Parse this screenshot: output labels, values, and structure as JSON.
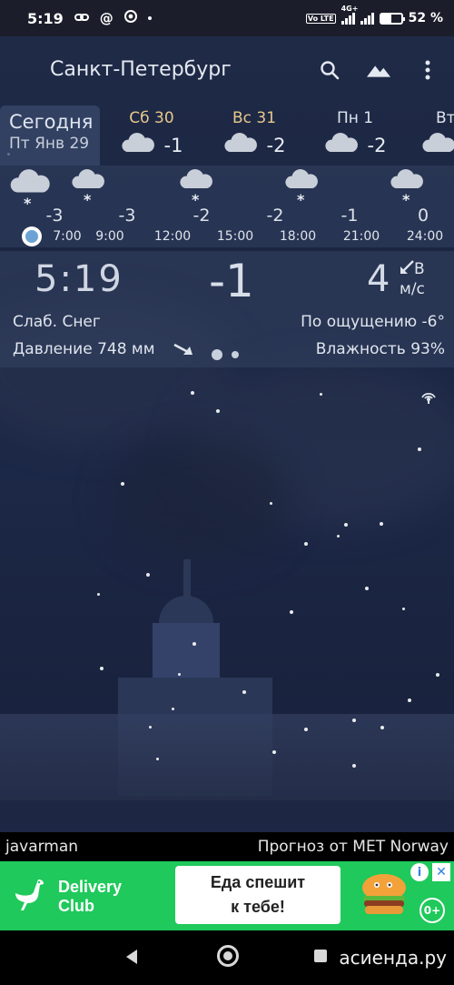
{
  "status_bar": {
    "time": "5:19",
    "icons": [
      "link-icon",
      "at-icon",
      "chrome-icon"
    ],
    "net_volte": "Vo LTE",
    "net_type": "4G+",
    "battery": "52 %",
    "battery_level": 0.52
  },
  "header": {
    "city": "Санкт-Петербург",
    "icons": [
      "search-icon",
      "landscape-icon",
      "more-vert-icon"
    ]
  },
  "days": {
    "today": {
      "label": "Сегодня",
      "date": "Пт Янв 29"
    },
    "items": [
      {
        "label": "Сб 30",
        "temp": "-1",
        "icon": "cloud-icon"
      },
      {
        "label": "Вс 31",
        "temp": "-2",
        "icon": "cloud-icon"
      },
      {
        "label": "Пн 1",
        "temp": "-2",
        "icon": "cloud-icon"
      },
      {
        "label": "Вт",
        "temp": "",
        "icon": "cloud-icon"
      }
    ]
  },
  "hourly": {
    "temps": [
      "-3",
      "-3",
      "-2",
      "-2",
      "-1",
      "0"
    ],
    "times": [
      "7:00",
      "9:00",
      "12:00",
      "15:00",
      "18:00",
      "21:00",
      "24:00"
    ],
    "icons": [
      "snow-cloud-icon",
      "snow-cloud-icon",
      "snow-cloud-icon",
      "snow-cloud-icon",
      "snow-cloud-icon"
    ]
  },
  "current": {
    "time": "5:19",
    "temp": "-1",
    "wind_speed": "4",
    "wind_dir": "В",
    "wind_unit": "м/с",
    "condition": "Слаб. Снег",
    "feels_like": "По ощущению -6°",
    "pressure": "Давление 748 мм",
    "humidity": "Влажность 93%"
  },
  "credits": {
    "author": "javarman",
    "source": "Прогноз от MET Norway"
  },
  "ad": {
    "brand_line1": "Delivery",
    "brand_line2": "Club",
    "tagline1": "Еда спешит",
    "tagline2": "к тебе!",
    "age": "0+",
    "info": "i",
    "close": "✕",
    "bg_color": "#1fc95b"
  },
  "navbar": {
    "watermark": "асиенда.ру"
  }
}
